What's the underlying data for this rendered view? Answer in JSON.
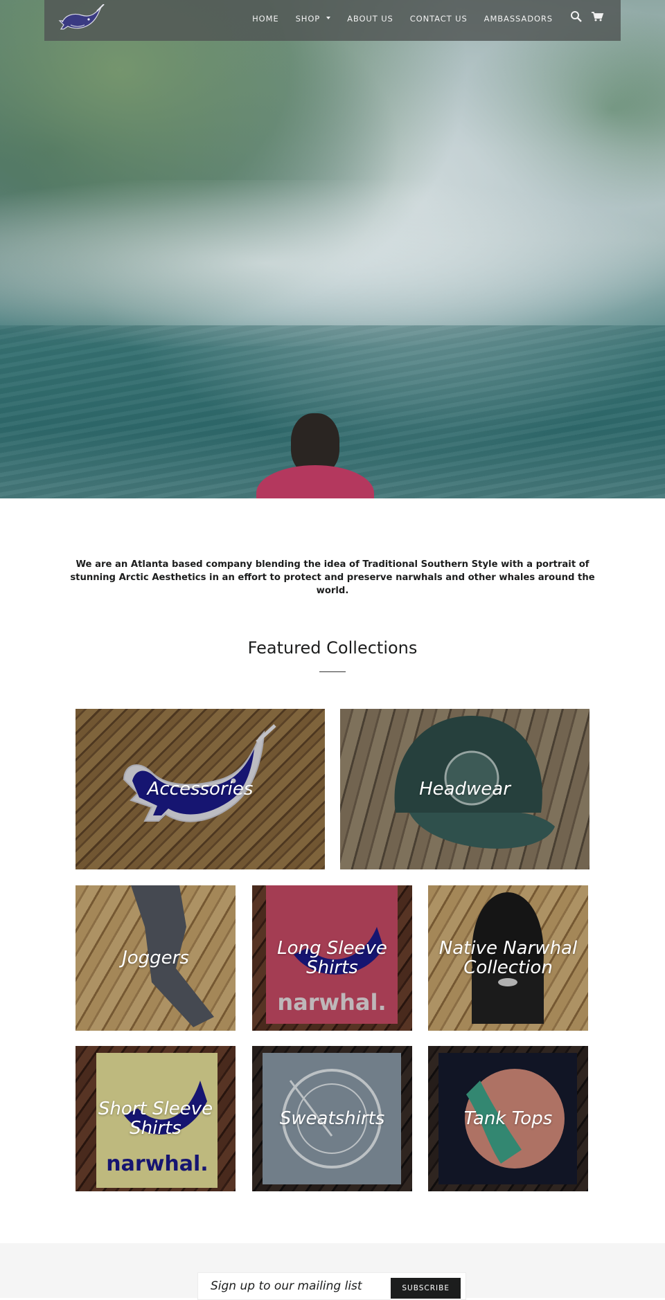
{
  "nav": {
    "links": [
      "Home",
      "Shop",
      "About Us",
      "Contact Us",
      "Ambassadors"
    ],
    "icons": [
      "search-icon",
      "cart-icon"
    ]
  },
  "intro": {
    "text": "We are an Atlanta based company blending the idea of Traditional Southern Style with a portrait of stunning Arctic Aesthetics in an effort to protect and preserve narwhals and other whales around the world."
  },
  "featured": {
    "title": "Featured Collections",
    "collections": [
      {
        "label": "Accessories"
      },
      {
        "label": "Headwear"
      },
      {
        "label": "Joggers"
      },
      {
        "label": "Long Sleeve Shirts"
      },
      {
        "label": "Native Narwhal Collection"
      },
      {
        "label": "Short Sleeve Shirts"
      },
      {
        "label": "Sweatshirts"
      },
      {
        "label": "Tank Tops"
      }
    ]
  },
  "newsletter": {
    "placeholder": "Sign up to our mailing list",
    "button": "Subscribe"
  },
  "colors": {
    "nav_bg": "#505554",
    "narwhal_blue": "#1f1d8a",
    "text": "#1c1d1d",
    "footer_bg": "#f5f5f5"
  }
}
